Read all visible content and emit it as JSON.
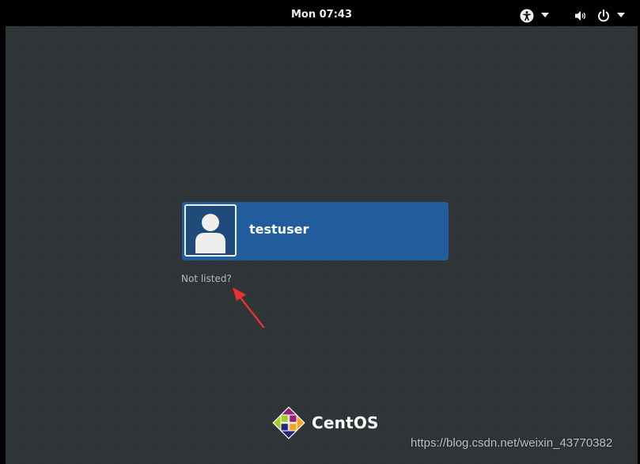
{
  "topbar": {
    "clock": "Mon 07:43",
    "icons": [
      "accessibility-icon",
      "dropdown-arrow-icon",
      "volume-icon",
      "power-icon",
      "dropdown-arrow-icon"
    ]
  },
  "login": {
    "username": "testuser",
    "not_listed_label": "Not listed?"
  },
  "branding": {
    "name": "CentOS",
    "logo": "centos-logo",
    "logo_colors": [
      "#9ccd2a",
      "#262577",
      "#932279",
      "#efa724"
    ]
  },
  "watermark": {
    "text": "https://blog.csdn.net/weixin_43770382"
  },
  "colors": {
    "background": "#2e3436",
    "topbar": "#000000",
    "user_card": "#215d9c",
    "annotation_arrow": "#e8322f"
  }
}
